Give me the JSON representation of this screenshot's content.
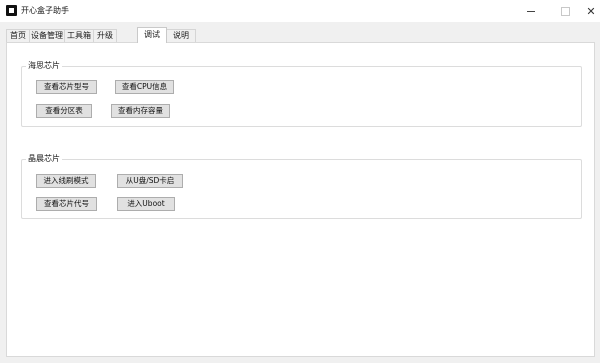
{
  "window": {
    "title": "开心盒子助手"
  },
  "tabs": [
    {
      "label": "首页"
    },
    {
      "label": "设备管理"
    },
    {
      "label": "工具箱"
    },
    {
      "label": "升级"
    },
    {
      "label": "调试"
    },
    {
      "label": "说明"
    }
  ],
  "active_tab": "调试",
  "groups": {
    "hisilicon": {
      "title": "海思芯片",
      "buttons": [
        {
          "label": "查看芯片型号"
        },
        {
          "label": "查看CPU信息"
        },
        {
          "label": "查看分区表"
        },
        {
          "label": "查看内存容量"
        }
      ]
    },
    "amlogic": {
      "title": "晶晨芯片",
      "buttons": [
        {
          "label": "进入线刷模式"
        },
        {
          "label": "从U盘/SD卡启"
        },
        {
          "label": "查看芯片代号"
        },
        {
          "label": "进入Uboot"
        }
      ]
    }
  }
}
